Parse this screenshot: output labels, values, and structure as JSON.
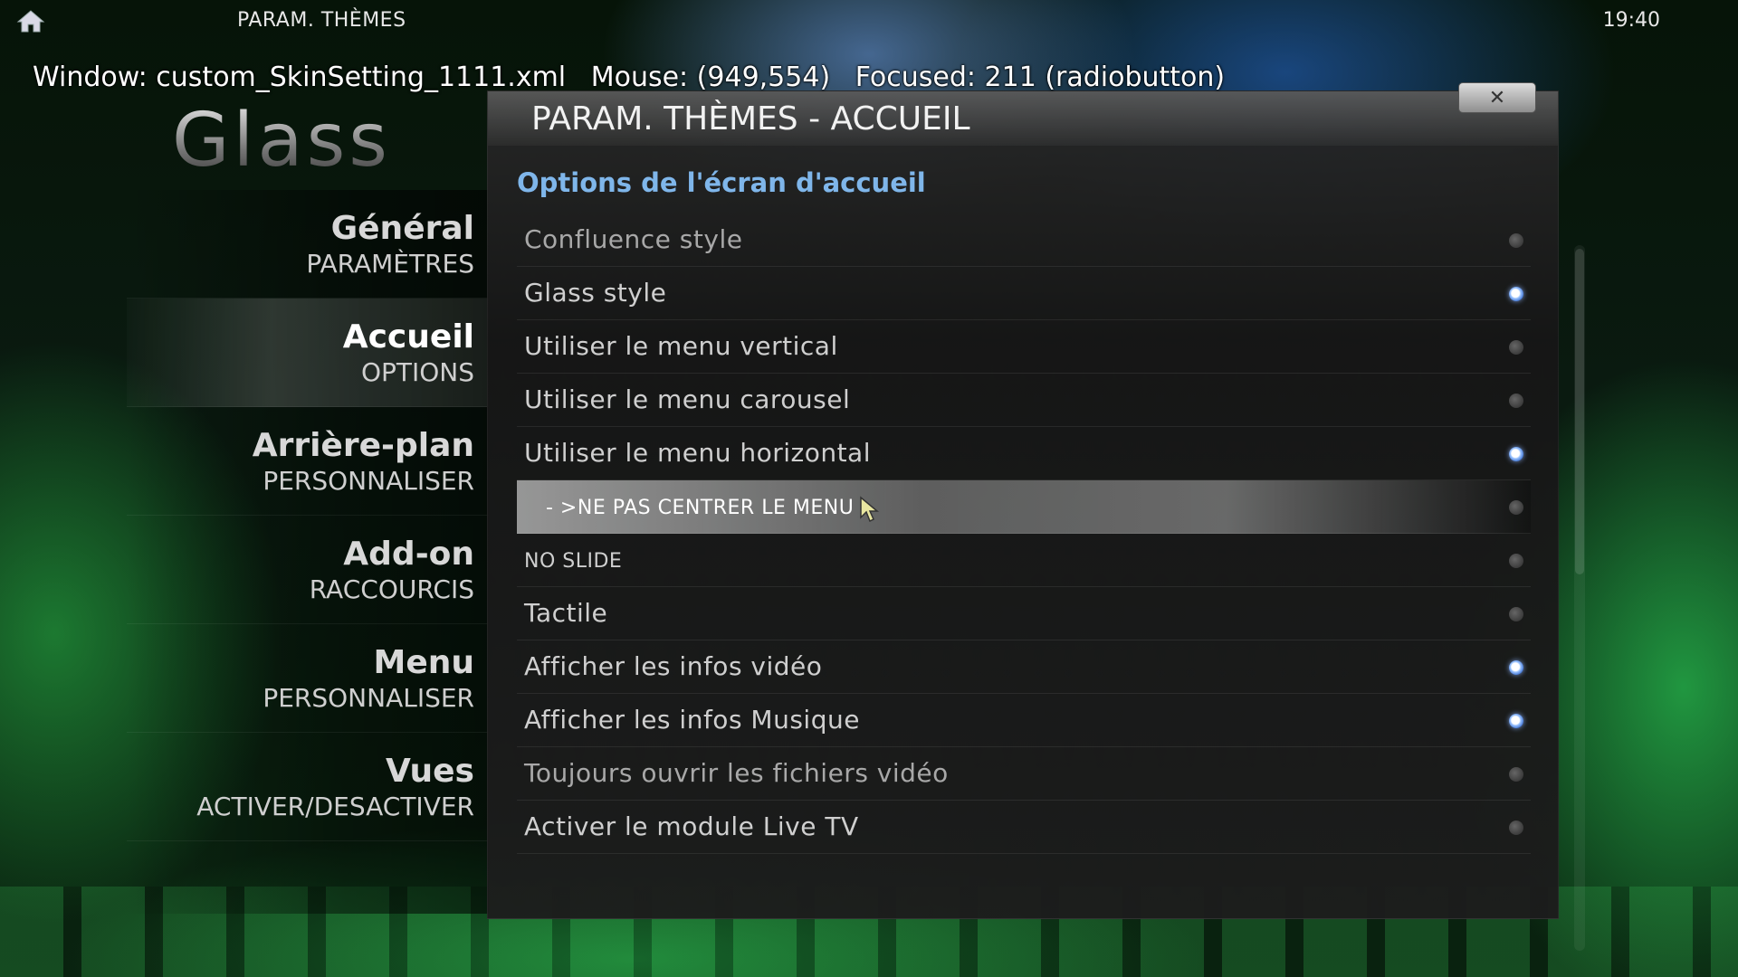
{
  "topbar": {
    "title": "PARAM. THÈMES",
    "clock": "19:40",
    "home_icon": "home-icon"
  },
  "debug": {
    "window": "Window: custom_SkinSetting_1111.xml",
    "mouse": "Mouse: (949,554)",
    "focused": "Focused: 211 (radiobutton)"
  },
  "logo": {
    "text": "Glass"
  },
  "sidebar": {
    "items": [
      {
        "title": "Général",
        "subtitle": "PARAMÈTRES",
        "active": false
      },
      {
        "title": "Accueil",
        "subtitle": "OPTIONS",
        "active": true
      },
      {
        "title": "Arrière-plan",
        "subtitle": "PERSONNALISER",
        "active": false
      },
      {
        "title": "Add-on",
        "subtitle": "RACCOURCIS",
        "active": false
      },
      {
        "title": "Menu",
        "subtitle": "PERSONNALISER",
        "active": false
      },
      {
        "title": "Vues",
        "subtitle": "ACTIVER/DESACTIVER",
        "active": false
      }
    ]
  },
  "panel": {
    "title": "PARAM. THÈMES - ACCUEIL",
    "close_icon": "close-icon",
    "close_glyph": "✕",
    "section_title": "Options de l'écran d'accueil",
    "options": [
      {
        "label": "Confluence style",
        "selected": false
      },
      {
        "label": "Glass style",
        "selected": true
      },
      {
        "label": "Utiliser le menu vertical",
        "selected": false
      },
      {
        "label": "Utiliser le menu carousel",
        "selected": false
      },
      {
        "label": "Utiliser le menu horizontal",
        "selected": true
      },
      {
        "label": "- >NE PAS CENTRER LE MENU",
        "selected": false,
        "focused": true
      },
      {
        "label": "NO SLIDE",
        "selected": false
      },
      {
        "label": "Tactile",
        "selected": false
      },
      {
        "label": "Afficher les infos vidéo",
        "selected": true
      },
      {
        "label": "Afficher les infos Musique",
        "selected": true
      },
      {
        "label": "Toujours ouvrir les fichiers vidéo",
        "selected": false
      },
      {
        "label": "Activer le module Live TV",
        "selected": false
      }
    ]
  },
  "colors": {
    "accent": "#7fb6ea",
    "radio_on": "#3a6fd0"
  }
}
